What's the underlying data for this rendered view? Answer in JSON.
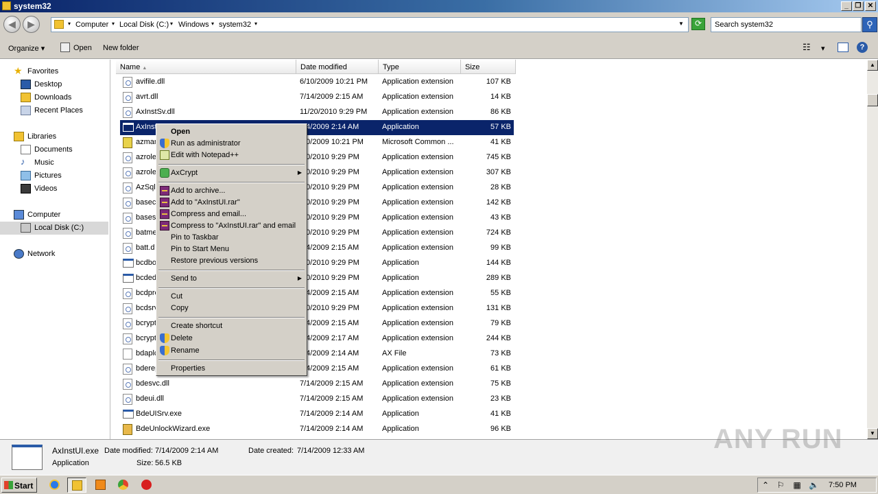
{
  "window": {
    "title": "system32"
  },
  "address": {
    "crumbs": [
      "Computer",
      "Local Disk (C:)",
      "Windows",
      "system32"
    ],
    "search_placeholder": "Search system32"
  },
  "toolbar": {
    "organize": "Organize",
    "open": "Open",
    "new_folder": "New folder"
  },
  "nav": {
    "favorites": "Favorites",
    "desktop": "Desktop",
    "downloads": "Downloads",
    "recent_places": "Recent Places",
    "libraries": "Libraries",
    "documents": "Documents",
    "music": "Music",
    "pictures": "Pictures",
    "videos": "Videos",
    "computer": "Computer",
    "local_disk": "Local Disk (C:)",
    "network": "Network"
  },
  "columns": {
    "name": "Name",
    "date": "Date modified",
    "type": "Type",
    "size": "Size"
  },
  "files": [
    {
      "name": "avifile.dll",
      "date": "6/10/2009 10:21 PM",
      "type": "Application extension",
      "size": "107 KB",
      "icon": "dll"
    },
    {
      "name": "avrt.dll",
      "date": "7/14/2009 2:15 AM",
      "type": "Application extension",
      "size": "14 KB",
      "icon": "dll"
    },
    {
      "name": "AxInstSv.dll",
      "date": "11/20/2010 9:29 PM",
      "type": "Application extension",
      "size": "86 KB",
      "icon": "dll"
    },
    {
      "name": "AxInst",
      "date": "/14/2009 2:14 AM",
      "type": "Application",
      "size": "57 KB",
      "icon": "exe",
      "selected": true
    },
    {
      "name": "azman",
      "date": "/10/2009 10:21 PM",
      "type": "Microsoft Common ...",
      "size": "41 KB",
      "icon": "msc"
    },
    {
      "name": "azrole",
      "date": "/20/2010 9:29 PM",
      "type": "Application extension",
      "size": "745 KB",
      "icon": "dll"
    },
    {
      "name": "azrole",
      "date": "/20/2010 9:29 PM",
      "type": "Application extension",
      "size": "307 KB",
      "icon": "dll"
    },
    {
      "name": "AzSqlE",
      "date": "/20/2010 9:29 PM",
      "type": "Application extension",
      "size": "28 KB",
      "icon": "dll"
    },
    {
      "name": "basecs",
      "date": "/20/2010 9:29 PM",
      "type": "Application extension",
      "size": "142 KB",
      "icon": "dll"
    },
    {
      "name": "basesr",
      "date": "/20/2010 9:29 PM",
      "type": "Application extension",
      "size": "43 KB",
      "icon": "dll"
    },
    {
      "name": "batme",
      "date": "/20/2010 9:29 PM",
      "type": "Application extension",
      "size": "724 KB",
      "icon": "dll"
    },
    {
      "name": "batt.d",
      "date": "/14/2009 2:15 AM",
      "type": "Application extension",
      "size": "99 KB",
      "icon": "dll"
    },
    {
      "name": "bcdbo",
      "date": "/20/2010 9:29 PM",
      "type": "Application",
      "size": "144 KB",
      "icon": "exe"
    },
    {
      "name": "bcded",
      "date": "/20/2010 9:29 PM",
      "type": "Application",
      "size": "289 KB",
      "icon": "exe"
    },
    {
      "name": "bcdprc",
      "date": "/14/2009 2:15 AM",
      "type": "Application extension",
      "size": "55 KB",
      "icon": "dll"
    },
    {
      "name": "bcdsrv",
      "date": "/20/2010 9:29 PM",
      "type": "Application extension",
      "size": "131 KB",
      "icon": "dll"
    },
    {
      "name": "bcrypt",
      "date": "/14/2009 2:15 AM",
      "type": "Application extension",
      "size": "79 KB",
      "icon": "dll"
    },
    {
      "name": "bcrypt",
      "date": "/14/2009 2:17 AM",
      "type": "Application extension",
      "size": "244 KB",
      "icon": "dll"
    },
    {
      "name": "bdaplc",
      "date": "/14/2009 2:14 AM",
      "type": "AX File",
      "size": "73 KB",
      "icon": "blank"
    },
    {
      "name": "bderep",
      "date": "/14/2009 2:15 AM",
      "type": "Application extension",
      "size": "61 KB",
      "icon": "dll"
    },
    {
      "name": "bdesvc.dll",
      "date": "7/14/2009 2:15 AM",
      "type": "Application extension",
      "size": "75 KB",
      "icon": "dll"
    },
    {
      "name": "bdeui.dll",
      "date": "7/14/2009 2:15 AM",
      "type": "Application extension",
      "size": "23 KB",
      "icon": "dll"
    },
    {
      "name": "BdeUISrv.exe",
      "date": "7/14/2009 2:14 AM",
      "type": "Application",
      "size": "41 KB",
      "icon": "exe"
    },
    {
      "name": "BdeUnlockWizard.exe",
      "date": "7/14/2009 2:14 AM",
      "type": "Application",
      "size": "96 KB",
      "icon": "wiz"
    }
  ],
  "context_menu": {
    "open": "Open",
    "run_as_admin": "Run as administrator",
    "edit_notepad": "Edit with Notepad++",
    "axcrypt": "AxCrypt",
    "add_archive": "Add to archive...",
    "add_rar": "Add to \"AxInstUI.rar\"",
    "compress_email": "Compress and email...",
    "compress_rar_email": "Compress to \"AxInstUI.rar\" and email",
    "pin_taskbar": "Pin to Taskbar",
    "pin_start": "Pin to Start Menu",
    "restore": "Restore previous versions",
    "send_to": "Send to",
    "cut": "Cut",
    "copy": "Copy",
    "create_shortcut": "Create shortcut",
    "delete": "Delete",
    "rename": "Rename",
    "properties": "Properties"
  },
  "details": {
    "filename": "AxInstUI.exe",
    "type": "Application",
    "date_modified_label": "Date modified:",
    "date_modified": "7/14/2009 2:14 AM",
    "date_created_label": "Date created:",
    "date_created": "7/14/2009 12:33 AM",
    "size_label": "Size:",
    "size": "56.5 KB"
  },
  "watermark": "ANY RUN",
  "taskbar": {
    "start": "Start",
    "clock": "7:50 PM"
  }
}
